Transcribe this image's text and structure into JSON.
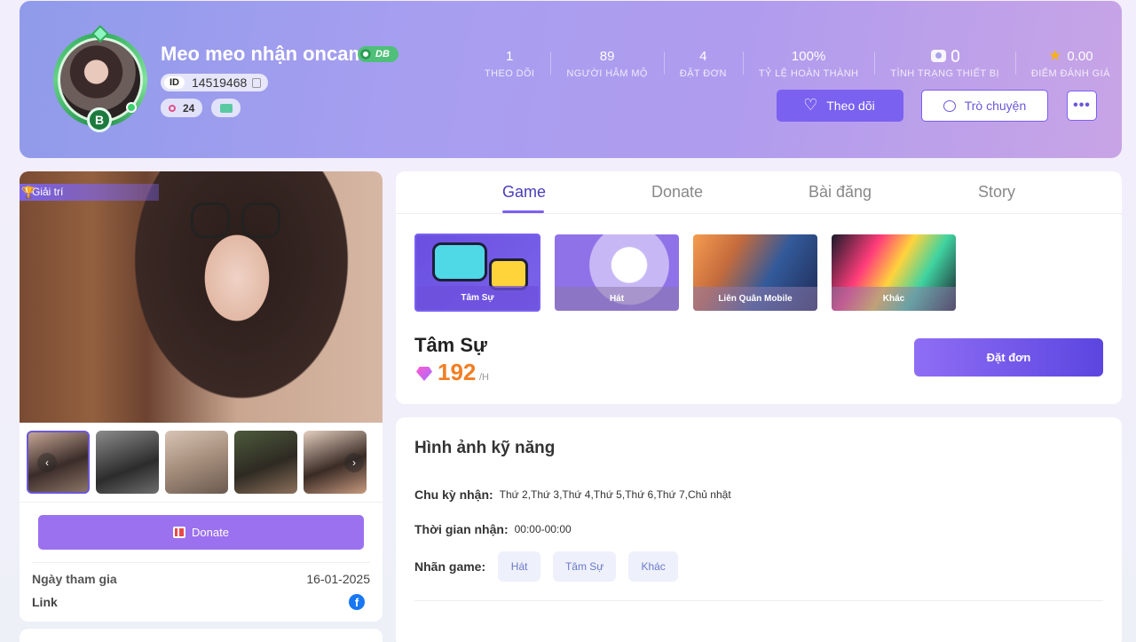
{
  "profile": {
    "name": "Meo meo nhận oncam",
    "rank_badge": "DB",
    "id_label": "ID",
    "id_value": "14519468",
    "pill_count": "24",
    "rank_letter": "B"
  },
  "stats": [
    {
      "value": "1",
      "label": "THEO DÕI"
    },
    {
      "value": "89",
      "label": "NGƯỜI HÂM MỘ"
    },
    {
      "value": "4",
      "label": "ĐẶT ĐƠN"
    },
    {
      "value": "100%",
      "label": "TỶ LỆ HOÀN THÀNH"
    },
    {
      "value": "",
      "label": "TÌNH TRẠNG THIẾT BỊ"
    },
    {
      "value": "0.00",
      "label": "ĐIỂM ĐÁNH GIÁ"
    }
  ],
  "actions": {
    "follow": "Theo dõi",
    "chat": "Trò chuyện",
    "more": "•••"
  },
  "left": {
    "category": "Giải trí",
    "donate": "Donate",
    "join_label": "Ngày tham gia",
    "join_date": "16-01-2025",
    "link_label": "Link"
  },
  "tabs": [
    "Game",
    "Donate",
    "Bài đăng",
    "Story"
  ],
  "games": [
    {
      "label": "Tâm Sự"
    },
    {
      "label": "Hát"
    },
    {
      "label": "Liên Quân Mobile"
    },
    {
      "label": "Khác"
    }
  ],
  "selected_game": {
    "title": "Tâm Sự",
    "price": "192",
    "unit": "/H",
    "order_button": "Đặt đơn"
  },
  "skill": {
    "title": "Hình ảnh kỹ năng",
    "schedule_label": "Chu kỳ nhận:",
    "schedule_value": "Thứ 2,Thứ 3,Thứ 4,Thứ 5,Thứ 6,Thứ 7,Chủ nhật",
    "time_label": "Thời gian nhận:",
    "time_value": "00:00-00:00",
    "tags_label": "Nhãn game:",
    "tags": [
      "Hát",
      "Tâm Sự",
      "Khác"
    ]
  },
  "colors": {
    "accent": "#7b61f0",
    "price": "#f17e24",
    "online": "#3bd16f"
  }
}
